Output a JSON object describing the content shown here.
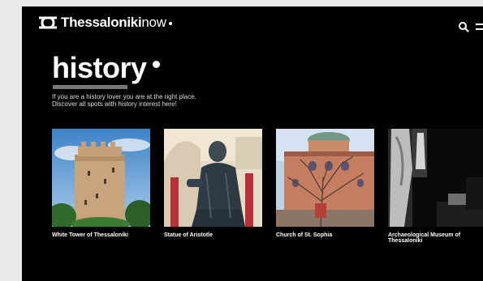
{
  "header": {
    "brand": "Thessaloniki",
    "brand_suffix": "now",
    "icons": [
      "logo-mark-icon",
      "search-icon",
      "menu-icon"
    ]
  },
  "page": {
    "title": "history",
    "intro_line1": "If you are a history lover you are at the right place.",
    "intro_line2": "Discover all spots with history interest here!"
  },
  "cards": [
    {
      "label": "White Tower of Thessaloniki",
      "image": "white-tower-photo"
    },
    {
      "label": "Statue of Aristotle",
      "image": "aristotle-statue-photo"
    },
    {
      "label": "Church of St. Sophia",
      "image": "st-sophia-church-photo"
    },
    {
      "label": "Archaeological Museum of Thessaloniki",
      "image": "archaeological-museum-photo"
    }
  ],
  "colors": {
    "background": "#000000",
    "outer": "#e9e9e9",
    "text": "#ffffff",
    "underline": "#777777"
  }
}
